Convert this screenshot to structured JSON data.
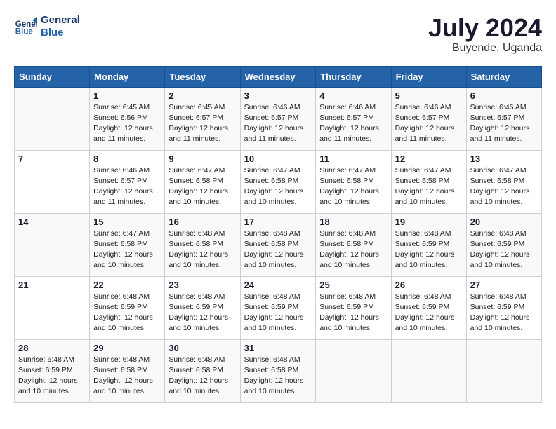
{
  "logo": {
    "line1": "General",
    "line2": "Blue"
  },
  "title": "July 2024",
  "location": "Buyende, Uganda",
  "weekdays": [
    "Sunday",
    "Monday",
    "Tuesday",
    "Wednesday",
    "Thursday",
    "Friday",
    "Saturday"
  ],
  "weeks": [
    [
      {
        "num": "",
        "info": ""
      },
      {
        "num": "1",
        "info": "Sunrise: 6:45 AM\nSunset: 6:56 PM\nDaylight: 12 hours\nand 11 minutes."
      },
      {
        "num": "2",
        "info": "Sunrise: 6:45 AM\nSunset: 6:57 PM\nDaylight: 12 hours\nand 11 minutes."
      },
      {
        "num": "3",
        "info": "Sunrise: 6:46 AM\nSunset: 6:57 PM\nDaylight: 12 hours\nand 11 minutes."
      },
      {
        "num": "4",
        "info": "Sunrise: 6:46 AM\nSunset: 6:57 PM\nDaylight: 12 hours\nand 11 minutes."
      },
      {
        "num": "5",
        "info": "Sunrise: 6:46 AM\nSunset: 6:57 PM\nDaylight: 12 hours\nand 11 minutes."
      },
      {
        "num": "6",
        "info": "Sunrise: 6:46 AM\nSunset: 6:57 PM\nDaylight: 12 hours\nand 11 minutes."
      }
    ],
    [
      {
        "num": "7",
        "info": ""
      },
      {
        "num": "8",
        "info": "Sunrise: 6:46 AM\nSunset: 6:57 PM\nDaylight: 12 hours\nand 11 minutes."
      },
      {
        "num": "9",
        "info": "Sunrise: 6:47 AM\nSunset: 6:58 PM\nDaylight: 12 hours\nand 10 minutes."
      },
      {
        "num": "10",
        "info": "Sunrise: 6:47 AM\nSunset: 6:58 PM\nDaylight: 12 hours\nand 10 minutes."
      },
      {
        "num": "11",
        "info": "Sunrise: 6:47 AM\nSunset: 6:58 PM\nDaylight: 12 hours\nand 10 minutes."
      },
      {
        "num": "12",
        "info": "Sunrise: 6:47 AM\nSunset: 6:58 PM\nDaylight: 12 hours\nand 10 minutes."
      },
      {
        "num": "13",
        "info": "Sunrise: 6:47 AM\nSunset: 6:58 PM\nDaylight: 12 hours\nand 10 minutes."
      }
    ],
    [
      {
        "num": "14",
        "info": ""
      },
      {
        "num": "15",
        "info": "Sunrise: 6:47 AM\nSunset: 6:58 PM\nDaylight: 12 hours\nand 10 minutes."
      },
      {
        "num": "16",
        "info": "Sunrise: 6:48 AM\nSunset: 6:58 PM\nDaylight: 12 hours\nand 10 minutes."
      },
      {
        "num": "17",
        "info": "Sunrise: 6:48 AM\nSunset: 6:58 PM\nDaylight: 12 hours\nand 10 minutes."
      },
      {
        "num": "18",
        "info": "Sunrise: 6:48 AM\nSunset: 6:58 PM\nDaylight: 12 hours\nand 10 minutes."
      },
      {
        "num": "19",
        "info": "Sunrise: 6:48 AM\nSunset: 6:59 PM\nDaylight: 12 hours\nand 10 minutes."
      },
      {
        "num": "20",
        "info": "Sunrise: 6:48 AM\nSunset: 6:59 PM\nDaylight: 12 hours\nand 10 minutes."
      }
    ],
    [
      {
        "num": "21",
        "info": ""
      },
      {
        "num": "22",
        "info": "Sunrise: 6:48 AM\nSunset: 6:59 PM\nDaylight: 12 hours\nand 10 minutes."
      },
      {
        "num": "23",
        "info": "Sunrise: 6:48 AM\nSunset: 6:59 PM\nDaylight: 12 hours\nand 10 minutes."
      },
      {
        "num": "24",
        "info": "Sunrise: 6:48 AM\nSunset: 6:59 PM\nDaylight: 12 hours\nand 10 minutes."
      },
      {
        "num": "25",
        "info": "Sunrise: 6:48 AM\nSunset: 6:59 PM\nDaylight: 12 hours\nand 10 minutes."
      },
      {
        "num": "26",
        "info": "Sunrise: 6:48 AM\nSunset: 6:59 PM\nDaylight: 12 hours\nand 10 minutes."
      },
      {
        "num": "27",
        "info": "Sunrise: 6:48 AM\nSunset: 6:59 PM\nDaylight: 12 hours\nand 10 minutes."
      }
    ],
    [
      {
        "num": "28",
        "info": "Sunrise: 6:48 AM\nSunset: 6:59 PM\nDaylight: 12 hours\nand 10 minutes."
      },
      {
        "num": "29",
        "info": "Sunrise: 6:48 AM\nSunset: 6:58 PM\nDaylight: 12 hours\nand 10 minutes."
      },
      {
        "num": "30",
        "info": "Sunrise: 6:48 AM\nSunset: 6:58 PM\nDaylight: 12 hours\nand 10 minutes."
      },
      {
        "num": "31",
        "info": "Sunrise: 6:48 AM\nSunset: 6:58 PM\nDaylight: 12 hours\nand 10 minutes."
      },
      {
        "num": "",
        "info": ""
      },
      {
        "num": "",
        "info": ""
      },
      {
        "num": "",
        "info": ""
      }
    ]
  ]
}
